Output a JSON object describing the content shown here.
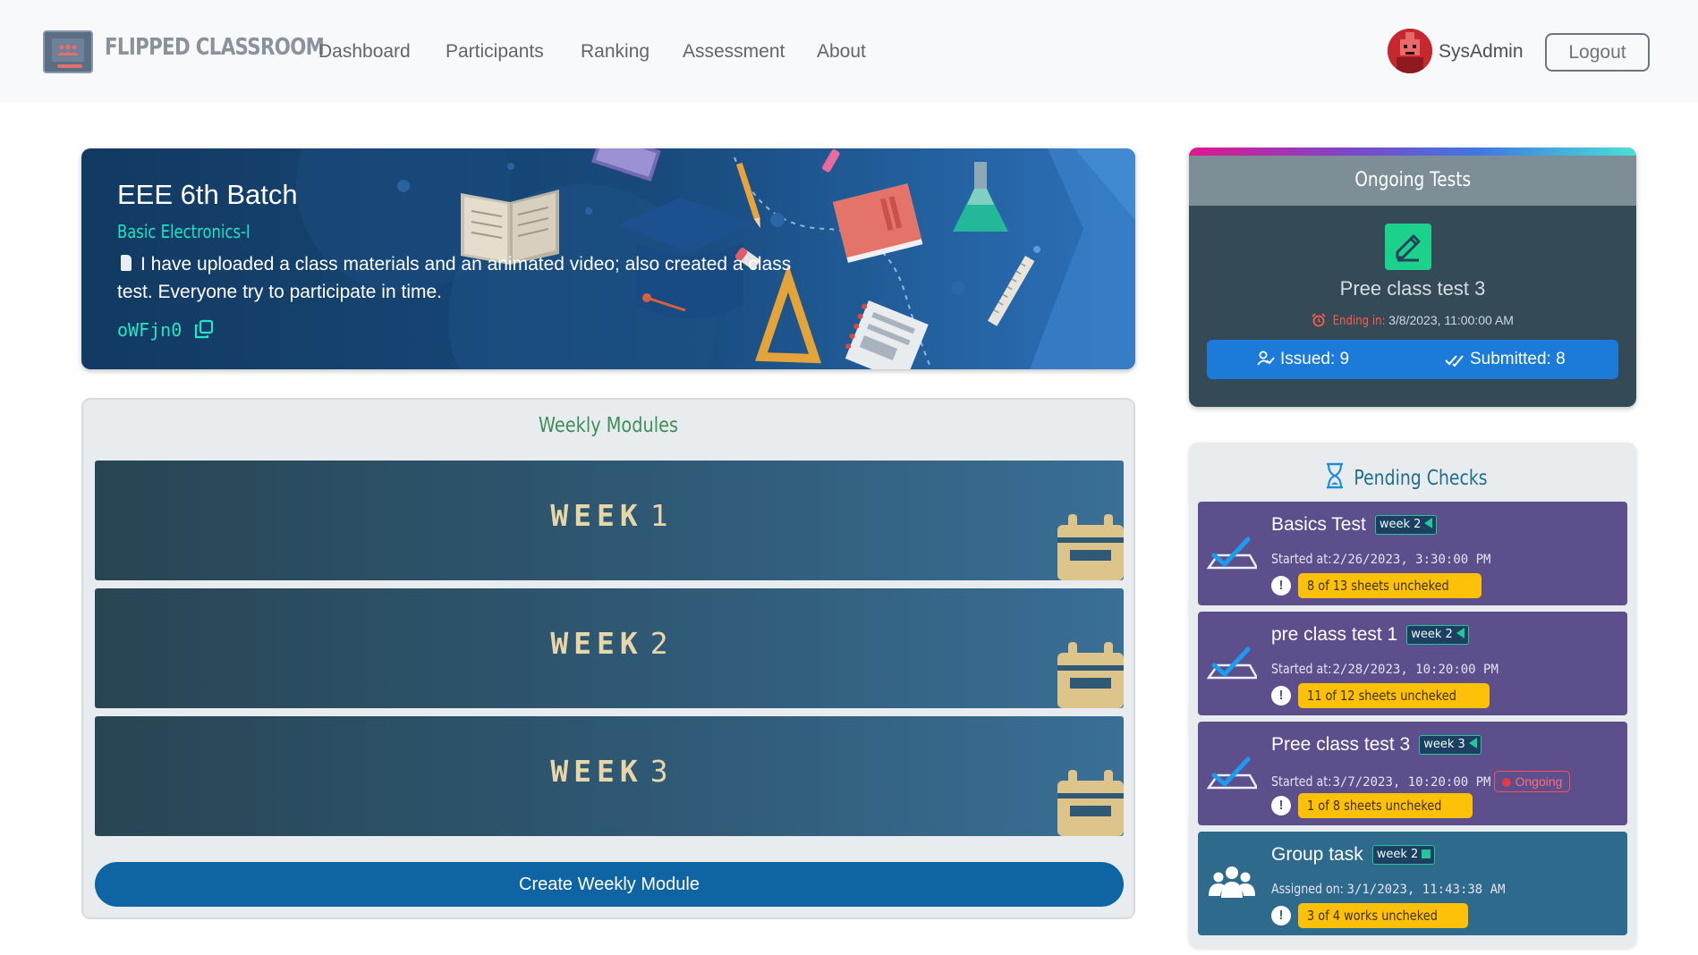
{
  "brand": {
    "name": "FLIPPED CLASSROOM"
  },
  "nav": {
    "links": [
      {
        "label": "Dashboard"
      },
      {
        "label": "Participants"
      },
      {
        "label": "Ranking"
      },
      {
        "label": "Assessment"
      },
      {
        "label": "About"
      }
    ],
    "user": {
      "name": "SysAdmin"
    },
    "logout_label": "Logout"
  },
  "banner": {
    "title": "EEE 6th Batch",
    "subtitle": "Basic Electronics-I",
    "announcement": "I have uploaded a class materials and an animated video; also created a class test. Everyone try to participate in time.",
    "class_code": "oWFjn0"
  },
  "modules": {
    "title": "Weekly Modules",
    "week_word": "WEEK",
    "weeks": [
      {
        "number": "1"
      },
      {
        "number": "2"
      },
      {
        "number": "3"
      }
    ],
    "create_label": "Create Weekly Module"
  },
  "ongoing": {
    "title": "Ongoing Tests",
    "test_name": "Pree class test 3",
    "ending_label": "Ending in:",
    "ending_value": "3/8/2023, 11:00:00 AM",
    "issued_label": "Issued:",
    "issued_value": "9",
    "submitted_label": "Submitted:",
    "submitted_value": "8"
  },
  "pending": {
    "title": "Pending Checks",
    "items": [
      {
        "title": "Basics Test",
        "week": "week 2",
        "badge_shape": "triangle",
        "started_label": "Started at:",
        "started_value": "2/26/2023, 3:30:00 PM",
        "unchecked": "8 of 13 sheets uncheked",
        "type": "test"
      },
      {
        "title": "pre class test 1",
        "week": "week 2",
        "badge_shape": "triangle",
        "started_label": "Started at:",
        "started_value": "2/28/2023, 10:20:00 PM",
        "unchecked": "11 of 12 sheets uncheked",
        "type": "test"
      },
      {
        "title": "Pree class test 3",
        "week": "week 3",
        "badge_shape": "triangle",
        "started_label": "Started at:",
        "started_value": "3/7/2023, 10:20:00 PM",
        "status": "Ongoing",
        "unchecked": "1 of 8 sheets uncheked",
        "type": "test"
      },
      {
        "title": "Group task",
        "week": "week 2",
        "badge_shape": "square",
        "started_label": "Assigned on:",
        "started_value": "3/1/2023, 11:43:38 AM",
        "unchecked": "3 of 4 works uncheked",
        "type": "group"
      }
    ]
  },
  "colors": {
    "banner_accent": "#1ee3c2",
    "pending_card": "#5c4f8c",
    "group_card": "#2e6a8c",
    "warning_badge": "#ffc107",
    "primary_button": "#0f65a3"
  },
  "icons": [
    "classroom-logo-icon",
    "pin-icon",
    "copy-icon",
    "calendar-icon",
    "pencil-square-icon",
    "alarm-icon",
    "person-check-icon",
    "double-check-icon",
    "hourglass-icon",
    "check-paper-icon",
    "group-icon",
    "exclamation-icon"
  ]
}
